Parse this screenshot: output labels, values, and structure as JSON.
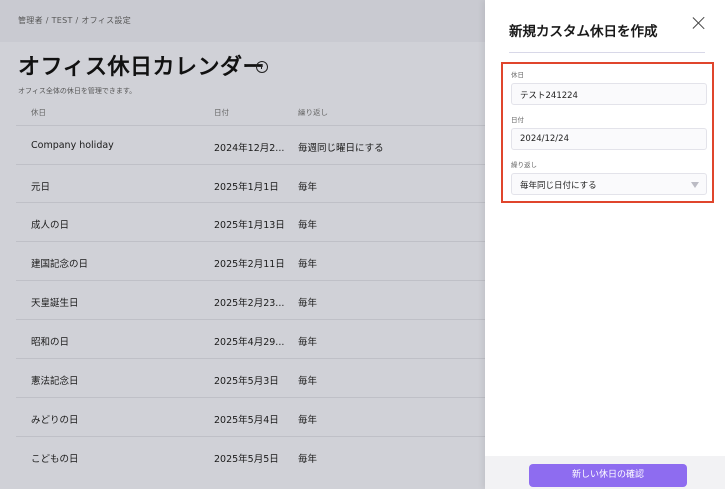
{
  "breadcrumb": "管理者 / TEST / オフィス設定",
  "page": {
    "title": "オフィス休日カレンダー",
    "subtitle": "オフィス全体の休日を管理できます。"
  },
  "table": {
    "headers": {
      "name": "休日",
      "date": "日付",
      "repeat": "繰り返し"
    },
    "rows": [
      {
        "name": "Company holiday",
        "date": "2024年12月2...",
        "repeat": "毎週同じ曜日にする"
      },
      {
        "name": "元日",
        "date": "2025年1月1日",
        "repeat": "毎年"
      },
      {
        "name": "成人の日",
        "date": "2025年1月13日",
        "repeat": "毎年"
      },
      {
        "name": "建国記念の日",
        "date": "2025年2月11日",
        "repeat": "毎年"
      },
      {
        "name": "天皇誕生日",
        "date": "2025年2月23...",
        "repeat": "毎年"
      },
      {
        "name": "昭和の日",
        "date": "2025年4月29...",
        "repeat": "毎年"
      },
      {
        "name": "憲法記念日",
        "date": "2025年5月3日",
        "repeat": "毎年"
      },
      {
        "name": "みどりの日",
        "date": "2025年5月4日",
        "repeat": "毎年"
      },
      {
        "name": "こどもの日",
        "date": "2025年5月5日",
        "repeat": "毎年"
      }
    ]
  },
  "panel": {
    "title": "新規カスタム休日を作成",
    "fields": {
      "holiday_label": "休日",
      "holiday_value": "テスト241224",
      "date_label": "日付",
      "date_value": "2024/12/24",
      "repeat_label": "繰り返し",
      "repeat_value": "毎年同じ日付にする"
    },
    "confirm_label": "新しい休日の確認"
  },
  "colors": {
    "accent": "#8e6cf0",
    "highlight_border": "#e0452c",
    "overlay": "#d0d1d7"
  }
}
